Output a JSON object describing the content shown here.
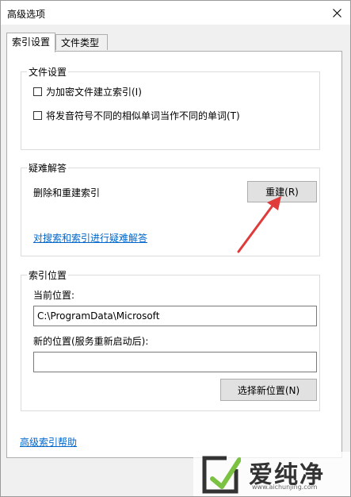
{
  "window": {
    "title": "高级选项"
  },
  "tabs": [
    {
      "label": "索引设置",
      "active": true
    },
    {
      "label": "文件类型",
      "active": false
    }
  ],
  "file_settings": {
    "title": "文件设置",
    "options": [
      {
        "label": "为加密文件建立索引(I)",
        "checked": false
      },
      {
        "label": "将发音符号不同的相似单词当作不同的单词(T)",
        "checked": false
      }
    ]
  },
  "troubleshoot": {
    "title": "疑难解答",
    "rebuild_desc": "删除和重建索引",
    "rebuild_button": "重建(R)",
    "link": "对搜索和索引进行疑难解答"
  },
  "index_location": {
    "title": "索引位置",
    "current_label": "当前位置:",
    "current_value": "C:\\ProgramData\\Microsoft",
    "new_label": "新的位置(服务重新启动后):",
    "new_value": "",
    "select_button": "选择新位置(N)"
  },
  "help_link": "高级索引帮助",
  "watermark": {
    "brand": "爱纯净",
    "site": "www.aichunjing.com"
  },
  "colors": {
    "link": "#0066cc",
    "arrow": "#e03a3a"
  }
}
